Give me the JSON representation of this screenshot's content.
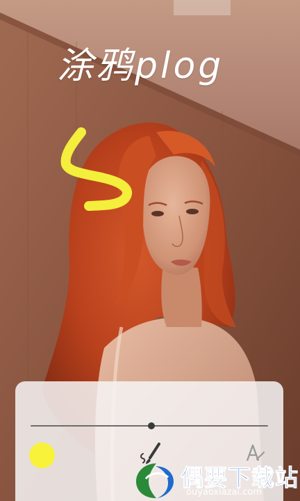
{
  "title": "涂鸦plog",
  "brush": {
    "color": "#f8f23a",
    "size_level": 0.51,
    "stroke_color": "#f4ee3c"
  },
  "toolbar": {
    "icons": [
      "brush-icon",
      "text-tool-icon"
    ]
  },
  "watermark": {
    "cn": "偶要下载站",
    "en": "ouyaoxiazai.com"
  }
}
